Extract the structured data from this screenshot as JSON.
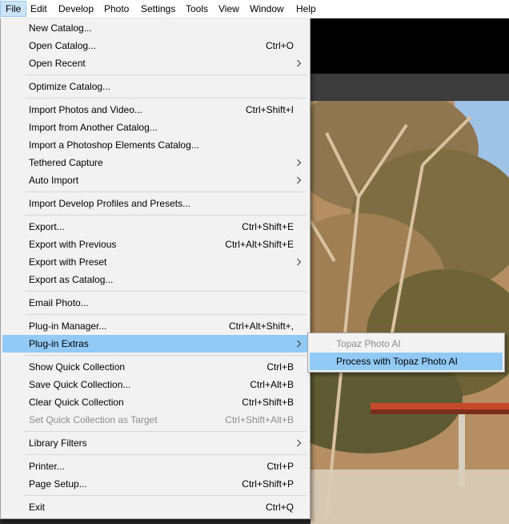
{
  "menubar": {
    "items": [
      "File",
      "Edit",
      "Develop",
      "Photo",
      "Settings",
      "Tools",
      "View",
      "Window",
      "Help"
    ],
    "active": "File"
  },
  "file_menu": [
    {
      "label": "New Catalog...",
      "shortcut": ""
    },
    {
      "label": "Open Catalog...",
      "shortcut": "Ctrl+O"
    },
    {
      "label": "Open Recent",
      "shortcut": "",
      "submenu": true
    },
    {
      "label": "Optimize Catalog...",
      "shortcut": ""
    },
    {
      "label": "Import Photos and Video...",
      "shortcut": "Ctrl+Shift+I"
    },
    {
      "label": "Import from Another Catalog...",
      "shortcut": ""
    },
    {
      "label": "Import a Photoshop Elements Catalog...",
      "shortcut": ""
    },
    {
      "label": "Tethered Capture",
      "shortcut": "",
      "submenu": true
    },
    {
      "label": "Auto Import",
      "shortcut": "",
      "submenu": true
    },
    {
      "label": "Import Develop Profiles and Presets...",
      "shortcut": ""
    },
    {
      "label": "Export...",
      "shortcut": "Ctrl+Shift+E"
    },
    {
      "label": "Export with Previous",
      "shortcut": "Ctrl+Alt+Shift+E"
    },
    {
      "label": "Export with Preset",
      "shortcut": "",
      "submenu": true
    },
    {
      "label": "Export as Catalog...",
      "shortcut": ""
    },
    {
      "label": "Email Photo...",
      "shortcut": ""
    },
    {
      "label": "Plug-in Manager...",
      "shortcut": "Ctrl+Alt+Shift+,"
    },
    {
      "label": "Plug-in Extras",
      "shortcut": "",
      "submenu": true,
      "highlighted": true
    },
    {
      "label": "Show Quick Collection",
      "shortcut": "Ctrl+B"
    },
    {
      "label": "Save Quick Collection...",
      "shortcut": "Ctrl+Alt+B"
    },
    {
      "label": "Clear Quick Collection",
      "shortcut": "Ctrl+Shift+B"
    },
    {
      "label": "Set Quick Collection as Target",
      "shortcut": "Ctrl+Shift+Alt+B",
      "disabled": true
    },
    {
      "label": "Library Filters",
      "shortcut": "",
      "submenu": true
    },
    {
      "label": "Printer...",
      "shortcut": "Ctrl+P"
    },
    {
      "label": "Page Setup...",
      "shortcut": "Ctrl+Shift+P"
    },
    {
      "label": "Exit",
      "shortcut": "Ctrl+Q"
    }
  ],
  "plugin_extras_submenu": [
    {
      "label": "Topaz Photo AI",
      "disabled": true
    },
    {
      "label": "Process with Topaz Photo AI",
      "highlighted": true
    }
  ],
  "colors": {
    "menu_bg": "#f2f2f2",
    "highlight": "#91c9f7",
    "menubar_active": "#cce4f7",
    "disabled_text": "#8d8d8d"
  },
  "icons": {
    "submenu_arrow": "chevron-right-icon"
  }
}
